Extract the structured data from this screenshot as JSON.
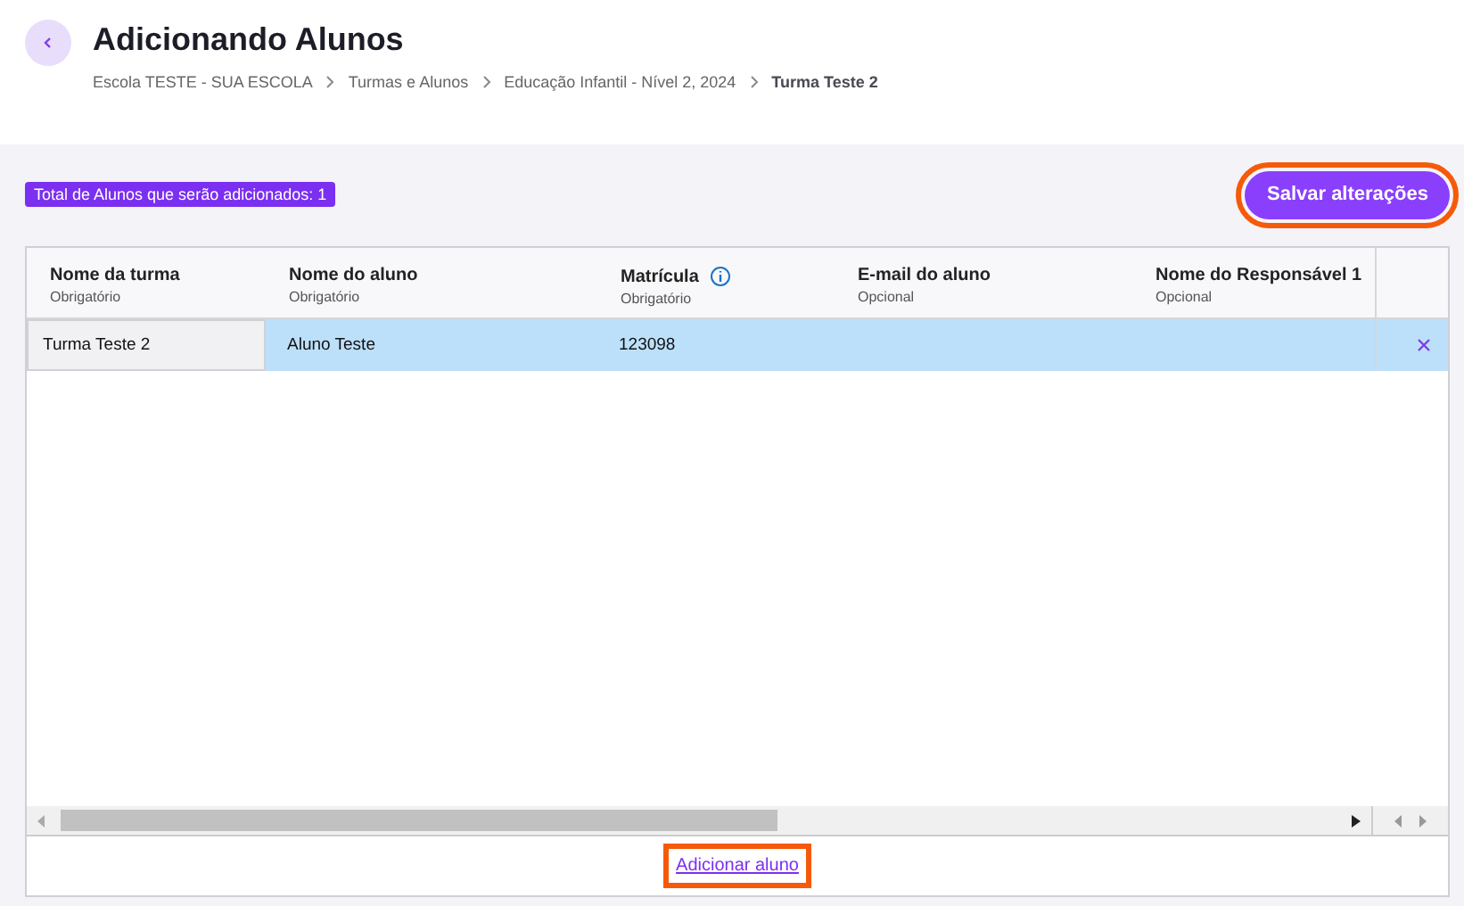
{
  "header": {
    "title": "Adicionando Alunos",
    "breadcrumbs": [
      "Escola TESTE - SUA ESCOLA",
      "Turmas e Alunos",
      "Educação Infantil - Nível 2, 2024",
      "Turma Teste 2"
    ]
  },
  "toolbar": {
    "count_badge": "Total de Alunos que serão adicionados: 1",
    "save_button": {
      "label": "Salvar alterações",
      "highlighted": true
    }
  },
  "table": {
    "columns": [
      {
        "label": "Nome da turma",
        "hint": "Obrigatório",
        "info": false
      },
      {
        "label": "Nome do aluno",
        "hint": "Obrigatório",
        "info": false
      },
      {
        "label": "Matrícula",
        "hint": "Obrigatório",
        "info": true
      },
      {
        "label": "E-mail do aluno",
        "hint": "Opcional",
        "info": false
      },
      {
        "label": "Nome do Responsável 1",
        "hint": "Opcional",
        "info": false
      }
    ],
    "rows": [
      {
        "cells": [
          "Turma Teste 2",
          "Aluno Teste",
          "123098",
          "",
          ""
        ],
        "selected": true
      }
    ]
  },
  "footer": {
    "add_link": {
      "label": "Adicionar aluno",
      "highlighted": true
    }
  }
}
